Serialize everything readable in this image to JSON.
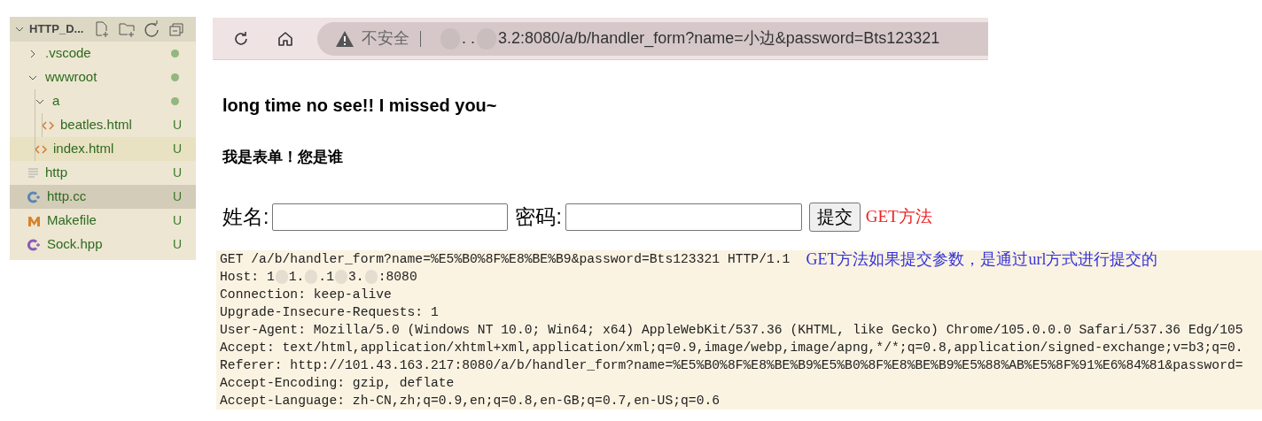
{
  "explorer": {
    "title": "HTTP_D...",
    "items": [
      {
        "label": ".vscode",
        "kind": "folder",
        "expanded": false,
        "selected": false,
        "focused": false,
        "dot": true
      },
      {
        "label": "wwwroot",
        "kind": "folder",
        "expanded": true,
        "selected": false,
        "focused": false,
        "dot": true,
        "children": [
          {
            "label": "a",
            "kind": "folder",
            "expanded": true,
            "selected": false,
            "focused": false,
            "dot": true,
            "children": [
              {
                "label": "beatles.html",
                "kind": "html",
                "selected": false,
                "focused": false,
                "dot": false,
                "badge": "U"
              }
            ]
          },
          {
            "label": "index.html",
            "kind": "html",
            "selected": false,
            "focused": true,
            "dot": false,
            "badge": "U"
          }
        ]
      },
      {
        "label": "http",
        "kind": "text",
        "selected": false,
        "focused": false,
        "dot": false,
        "badge": "U"
      },
      {
        "label": "http.cc",
        "kind": "cpp",
        "selected": true,
        "focused": false,
        "dot": false,
        "badge": "U"
      },
      {
        "label": "Makefile",
        "kind": "make",
        "selected": false,
        "focused": false,
        "dot": false,
        "badge": "U"
      },
      {
        "label": "Sock.hpp",
        "kind": "hpp",
        "selected": false,
        "focused": false,
        "dot": false,
        "badge": "U"
      }
    ]
  },
  "browser": {
    "security": "不安全",
    "url_parts": [
      ". .",
      "3.2",
      ":8080/a/b/handler_form?name=小边&password=Bts123321"
    ]
  },
  "page": {
    "heading": "long time no see!! I missed you~",
    "subheading": "我是表单！您是谁",
    "form": {
      "name_label": "姓名:",
      "password_label": "密码:",
      "submit": "提交",
      "note": "GET方法"
    },
    "request": {
      "first_line": "GET /a/b/handler_form?name=%E5%B0%8F%E8%BE%B9&password=Bts123321 HTTP/1.1",
      "annotation": "GET方法如果提交参数，是通过url方式进行提交的",
      "host_parts": [
        "Host: 1",
        "1.",
        ".1",
        "3.",
        ":8080"
      ],
      "lines": [
        "Connection: keep-alive",
        "Upgrade-Insecure-Requests: 1",
        "User-Agent: Mozilla/5.0 (Windows NT 10.0; Win64; x64) AppleWebKit/537.36 (KHTML, like Gecko) Chrome/105.0.0.0 Safari/537.36 Edg/105",
        "Accept: text/html,application/xhtml+xml,application/xml;q=0.9,image/webp,image/apng,*/*;q=0.8,application/signed-exchange;v=b3;q=0.",
        "Referer: http://101.43.163.217:8080/a/b/handler_form?name=%E5%B0%8F%E8%BE%B9%E5%B0%8F%E8%BE%B9%E5%88%AB%E5%8F%91%E6%84%81&password=",
        "Accept-Encoding: gzip, deflate",
        "Accept-Language: zh-CN,zh;q=0.9,en;q=0.8,en-GB;q=0.7,en-US;q=0.6"
      ]
    }
  }
}
